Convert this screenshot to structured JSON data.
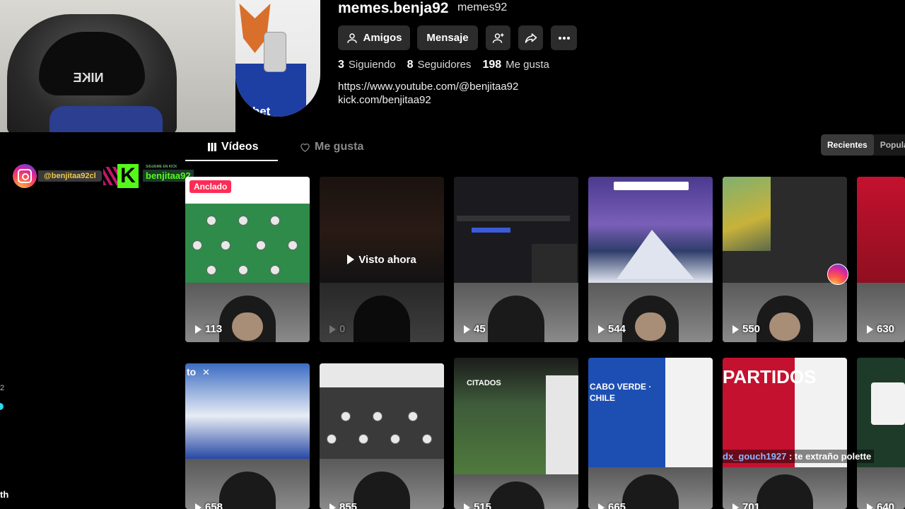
{
  "profile": {
    "username": "memes.benja92",
    "nickname": "memes92",
    "buttons": {
      "friends": "Amigos",
      "message": "Mensaje"
    },
    "stats": [
      {
        "value": "3",
        "label": "Siguiendo"
      },
      {
        "value": "8",
        "label": "Seguidores"
      },
      {
        "value": "198",
        "label": "Me gusta"
      }
    ],
    "links": [
      "https://www.youtube.com/@benjitaa92",
      "kick.com/benjitaa92"
    ],
    "avatar_text": "gabet"
  },
  "tabs": {
    "videos": "Vídeos",
    "liked": "Me gusta"
  },
  "sort": {
    "recent": "Recientes",
    "popular": "Popula"
  },
  "overlay": {
    "instagram_handle": "@benjitaa92cl",
    "kick_handle": "benjitaa92",
    "kick_tag": "SIGUEME EN KICK",
    "cap_logo": "NIKE"
  },
  "videos_row1": [
    {
      "views": "113",
      "badge": "Anclado"
    },
    {
      "views": "0",
      "watched_label": "Visto ahora"
    },
    {
      "views": "45"
    },
    {
      "views": "544"
    },
    {
      "views": "550"
    },
    {
      "views": "630"
    }
  ],
  "videos_row2": [
    {
      "views": "658",
      "thumb_text": "to"
    },
    {
      "views": "855"
    },
    {
      "views": "515",
      "thumb_text": "CITADOS"
    },
    {
      "views": "665",
      "thumb_text": "CABO VERDE · CHILE"
    },
    {
      "views": "701",
      "thumb_text": "PARTIDOS"
    },
    {
      "views": "640"
    }
  ],
  "chat_message": {
    "user": "dx_gouch1927",
    "text": ": te extraño polette"
  },
  "left_fragments": [
    "2",
    "th"
  ],
  "colors": {
    "background": "#000000",
    "button": "#2c2c2c",
    "accent_pink": "#fe2c55",
    "kick_green": "#53fc18"
  }
}
